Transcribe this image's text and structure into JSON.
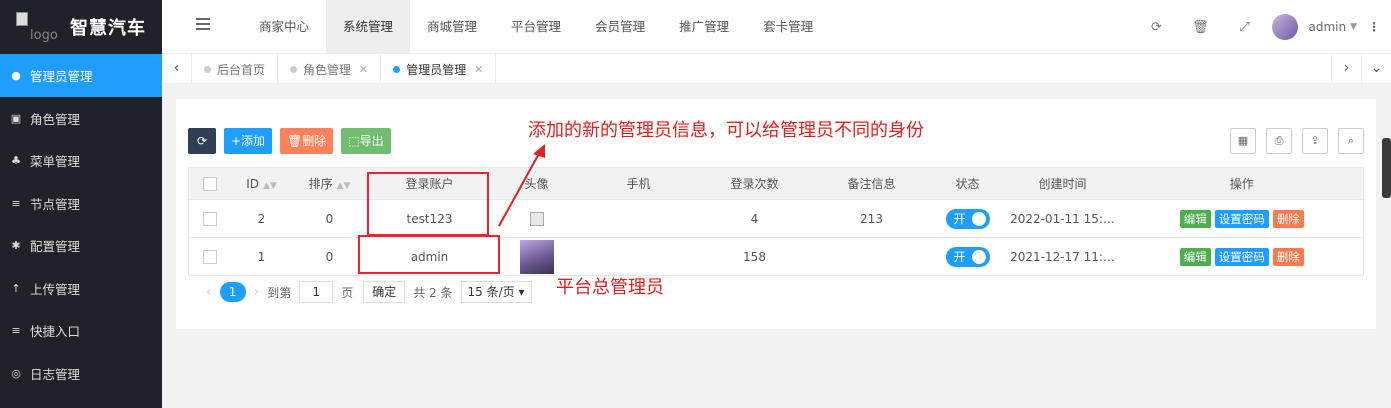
{
  "sidebar": {
    "logo_alt": "logo",
    "title": "智慧汽车",
    "items": [
      {
        "label": "管理员管理",
        "icon": "person-icon",
        "glyph": "●"
      },
      {
        "label": "角色管理",
        "icon": "role-icon",
        "glyph": "▣"
      },
      {
        "label": "菜单管理",
        "icon": "tree-icon",
        "glyph": "♣"
      },
      {
        "label": "节点管理",
        "icon": "list-icon",
        "glyph": "≡"
      },
      {
        "label": "配置管理",
        "icon": "gear-icon",
        "glyph": "✱"
      },
      {
        "label": "上传管理",
        "icon": "upload-icon",
        "glyph": "↑"
      },
      {
        "label": "快捷入口",
        "icon": "list-icon",
        "glyph": "≡"
      },
      {
        "label": "日志管理",
        "icon": "log-icon",
        "glyph": "◎"
      }
    ]
  },
  "header": {
    "nav": [
      "商家中心",
      "系统管理",
      "商城管理",
      "平台管理",
      "会员管理",
      "推广管理",
      "套卡管理"
    ],
    "username": "admin"
  },
  "tabs": {
    "items": [
      {
        "label": "后台首页",
        "closable": false
      },
      {
        "label": "角色管理",
        "closable": true
      },
      {
        "label": "管理员管理",
        "closable": true
      }
    ]
  },
  "toolbar": {
    "refresh": "⟳",
    "add": "+添加",
    "delete": "🗑删除",
    "export": "⬚导出"
  },
  "table": {
    "headers": {
      "id": "ID",
      "sort": "排序",
      "account": "登录账户",
      "avatar": "头像",
      "phone": "手机",
      "logins": "登录次数",
      "remark": "备注信息",
      "status": "状态",
      "created": "创建时间",
      "actions": "操作"
    },
    "rows": [
      {
        "id": "2",
        "sort": "0",
        "account": "test123",
        "phone": "",
        "logins": "4",
        "remark": "213",
        "status": "开",
        "created": "2022-01-11 15:…"
      },
      {
        "id": "1",
        "sort": "0",
        "account": "admin",
        "phone": "",
        "logins": "158",
        "remark": "",
        "status": "开",
        "created": "2021-12-17 11:…"
      }
    ],
    "actions": {
      "edit": "编辑",
      "pwd": "设置密码",
      "del": "删除"
    }
  },
  "pager": {
    "current": "1",
    "goto": "到第",
    "page_value": "1",
    "page_unit": "页",
    "confirm": "确定",
    "total": "共 2 条",
    "per_page": "15 条/页"
  },
  "annotations": {
    "top": "添加的新的管理员信息，可以给管理员不同的身份",
    "bottom": "平台总管理员"
  },
  "colors": {
    "accent": "#1e9fff",
    "sidebar_bg": "#20222a",
    "annotation": "#e02020"
  }
}
